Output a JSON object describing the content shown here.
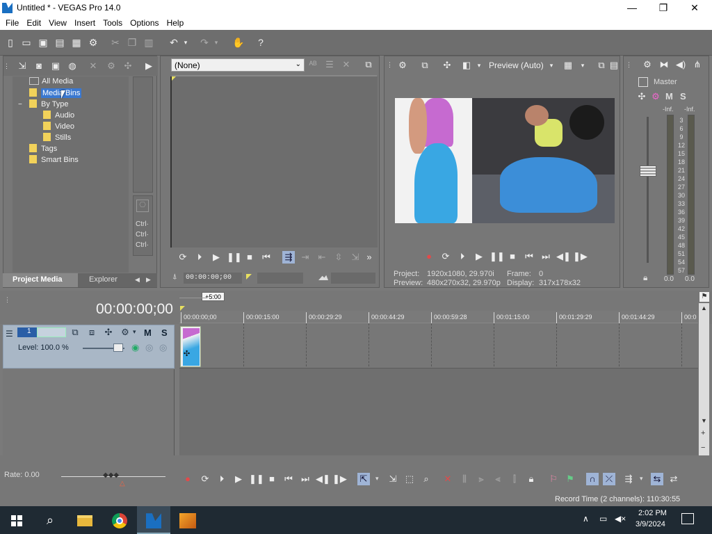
{
  "window": {
    "title": "Untitled * - VEGAS Pro 14.0",
    "minimize": "—",
    "maximize": "❐",
    "close": "✕"
  },
  "menu": [
    "File",
    "Edit",
    "View",
    "Insert",
    "Tools",
    "Options",
    "Help"
  ],
  "project_media": {
    "tree": [
      {
        "label": "All Media"
      },
      {
        "label": "Media Bins",
        "selected": true
      },
      {
        "label": "By Type",
        "expander": "−"
      },
      {
        "label": "Audio"
      },
      {
        "label": "Video"
      },
      {
        "label": "Stills"
      },
      {
        "label": "Tags"
      },
      {
        "label": "Smart Bins"
      }
    ],
    "shortcuts": [
      "Ctrl·",
      "Ctrl·",
      "Ctrl·"
    ],
    "tabs": [
      {
        "label": "Project Media",
        "active": true
      },
      {
        "label": "Explorer"
      }
    ]
  },
  "trimmer": {
    "dropdown": "(None)",
    "timecode": "00:00:00;00"
  },
  "preview": {
    "mode": "Preview (Auto)",
    "project_label": "Project:",
    "project_value": "1920x1080, 29.970i",
    "frame_label": "Frame:",
    "frame_value": "0",
    "preview_label": "Preview:",
    "preview_value": "480x270x32, 29.970p",
    "display_label": "Display:",
    "display_value": "317x178x32"
  },
  "master": {
    "label": "Master",
    "m": "M",
    "s": "S",
    "inf_left": "-Inf.",
    "inf_right": "-Inf.",
    "scale": [
      "3",
      "6",
      "9",
      "12",
      "15",
      "18",
      "21",
      "24",
      "27",
      "30",
      "33",
      "36",
      "39",
      "42",
      "45",
      "48",
      "51",
      "54",
      "57"
    ],
    "val_left": "0.0",
    "val_right": "0.0"
  },
  "timeline": {
    "timecode": "00:00:00;00",
    "offset_badge": "+5:00",
    "ruler": [
      "00:00:00;00",
      "00:00:15:00",
      "00:00:29:29",
      "00:00:44:29",
      "00:00:59:28",
      "00:01:15:00",
      "00:01:29:29",
      "00:01:44:29",
      "00:0"
    ],
    "track": {
      "number": "1",
      "m": "M",
      "s": "S",
      "level": "Level: 100.0 %"
    }
  },
  "bottom": {
    "rate": "Rate: 0.00"
  },
  "status": {
    "record_time": "Record Time (2 channels): 110:30:55"
  },
  "taskbar": {
    "time": "2:02 PM",
    "date": "3/9/2024"
  },
  "colors": {
    "accent": "#3a78d0",
    "track": "#a9b7c6",
    "selected": "#3a78d0"
  }
}
